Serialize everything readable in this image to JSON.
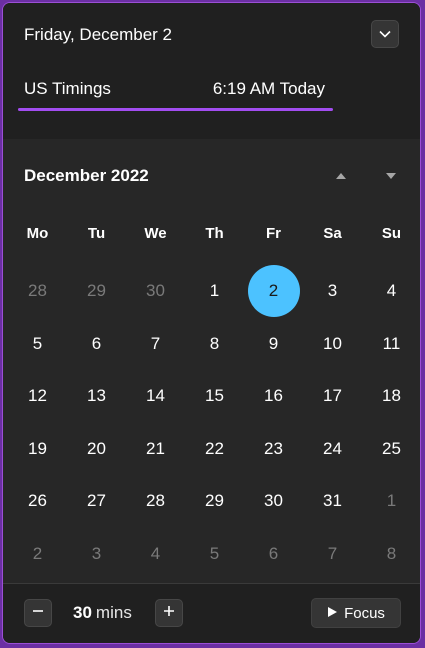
{
  "header": {
    "date_title": "Friday, December 2",
    "timezone_name": "US Timings",
    "timezone_time": "6:19 AM Today"
  },
  "calendar": {
    "month_title": "December 2022",
    "weekdays": [
      "Mo",
      "Tu",
      "We",
      "Th",
      "Fr",
      "Sa",
      "Su"
    ],
    "weeks": [
      [
        {
          "d": "28",
          "muted": true
        },
        {
          "d": "29",
          "muted": true
        },
        {
          "d": "30",
          "muted": true
        },
        {
          "d": "1"
        },
        {
          "d": "2",
          "selected": true
        },
        {
          "d": "3"
        },
        {
          "d": "4"
        }
      ],
      [
        {
          "d": "5"
        },
        {
          "d": "6"
        },
        {
          "d": "7"
        },
        {
          "d": "8"
        },
        {
          "d": "9"
        },
        {
          "d": "10"
        },
        {
          "d": "11"
        }
      ],
      [
        {
          "d": "12"
        },
        {
          "d": "13"
        },
        {
          "d": "14"
        },
        {
          "d": "15"
        },
        {
          "d": "16"
        },
        {
          "d": "17"
        },
        {
          "d": "18"
        }
      ],
      [
        {
          "d": "19"
        },
        {
          "d": "20"
        },
        {
          "d": "21"
        },
        {
          "d": "22"
        },
        {
          "d": "23"
        },
        {
          "d": "24"
        },
        {
          "d": "25"
        }
      ],
      [
        {
          "d": "26"
        },
        {
          "d": "27"
        },
        {
          "d": "28"
        },
        {
          "d": "29"
        },
        {
          "d": "30"
        },
        {
          "d": "31"
        },
        {
          "d": "1",
          "muted": true
        }
      ],
      [
        {
          "d": "2",
          "muted": true
        },
        {
          "d": "3",
          "muted": true
        },
        {
          "d": "4",
          "muted": true
        },
        {
          "d": "5",
          "muted": true
        },
        {
          "d": "6",
          "muted": true
        },
        {
          "d": "7",
          "muted": true
        },
        {
          "d": "8",
          "muted": true
        }
      ]
    ]
  },
  "focus": {
    "duration_value": "30",
    "duration_unit": "mins",
    "button_label": "Focus"
  },
  "colors": {
    "accent": "#4cc2ff",
    "underline": "#a24df0",
    "background": "#272727"
  },
  "icons": {
    "collapse": "chevron-down-icon",
    "prev_month": "triangle-up-icon",
    "next_month": "triangle-down-icon",
    "decrement": "minus-icon",
    "increment": "plus-icon",
    "focus": "play-icon"
  }
}
